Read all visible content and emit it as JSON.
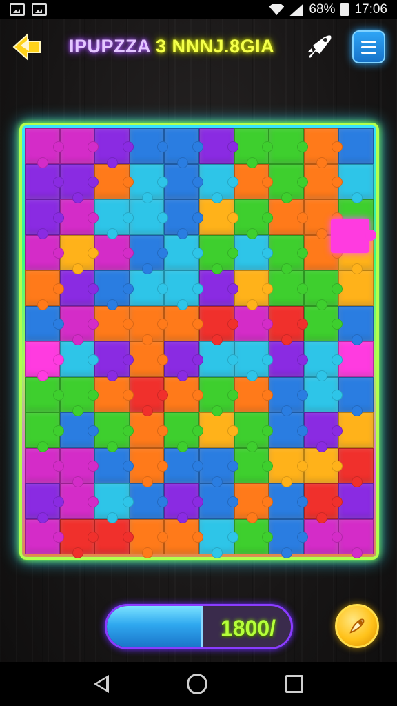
{
  "status_bar": {
    "battery": "68%",
    "time": "17:06"
  },
  "header": {
    "title_part1": "IPUPZZA",
    "title_part2": "3 NNNJ.8GIA",
    "back_icon": "back-arrow-icon",
    "rocket_icon": "rocket-icon",
    "menu_icon": "menu-icon"
  },
  "board": {
    "columns": 10,
    "rows": 12,
    "colors": {
      "purple": "#8a2be2",
      "magenta": "#d42cc8",
      "blue": "#2a7de1",
      "cyan": "#2ec5e8",
      "green": "#3ecf2e",
      "lime": "#7fe01f",
      "orange": "#ff7a1a",
      "yellow": "#ffb21a",
      "red": "#f0302c",
      "pink": "#ff3be0"
    },
    "tiles": [
      "magenta",
      "magenta",
      "purple",
      "blue",
      "blue",
      "purple",
      "green",
      "green",
      "orange",
      "blue",
      "purple",
      "purple",
      "orange",
      "cyan",
      "blue",
      "cyan",
      "orange",
      "green",
      "orange",
      "cyan",
      "purple",
      "magenta",
      "cyan",
      "cyan",
      "blue",
      "yellow",
      "green",
      "orange",
      "orange",
      "green",
      "magenta",
      "yellow",
      "magenta",
      "blue",
      "cyan",
      "green",
      "cyan",
      "green",
      "orange",
      "yellow",
      "orange",
      "purple",
      "blue",
      "cyan",
      "cyan",
      "purple",
      "yellow",
      "green",
      "green",
      "yellow",
      "blue",
      "magenta",
      "orange",
      "orange",
      "orange",
      "red",
      "magenta",
      "red",
      "green",
      "blue",
      "pink",
      "cyan",
      "purple",
      "orange",
      "purple",
      "cyan",
      "cyan",
      "purple",
      "cyan",
      "pink",
      "green",
      "green",
      "orange",
      "red",
      "orange",
      "green",
      "orange",
      "blue",
      "cyan",
      "blue",
      "green",
      "blue",
      "green",
      "orange",
      "green",
      "yellow",
      "green",
      "blue",
      "purple",
      "yellow",
      "magenta",
      "magenta",
      "blue",
      "orange",
      "blue",
      "blue",
      "green",
      "yellow",
      "yellow",
      "red",
      "purple",
      "magenta",
      "cyan",
      "blue",
      "purple",
      "blue",
      "orange",
      "blue",
      "red",
      "purple",
      "magenta",
      "red",
      "red",
      "orange",
      "orange",
      "cyan",
      "green",
      "blue",
      "magenta",
      "magenta"
    ]
  },
  "progress": {
    "label": "1800/",
    "fraction": 0.52
  },
  "coin_icon": "coin-icon",
  "nav": {
    "back_icon": "nav-back-icon",
    "home_icon": "nav-home-icon",
    "recent_icon": "nav-recent-icon"
  }
}
